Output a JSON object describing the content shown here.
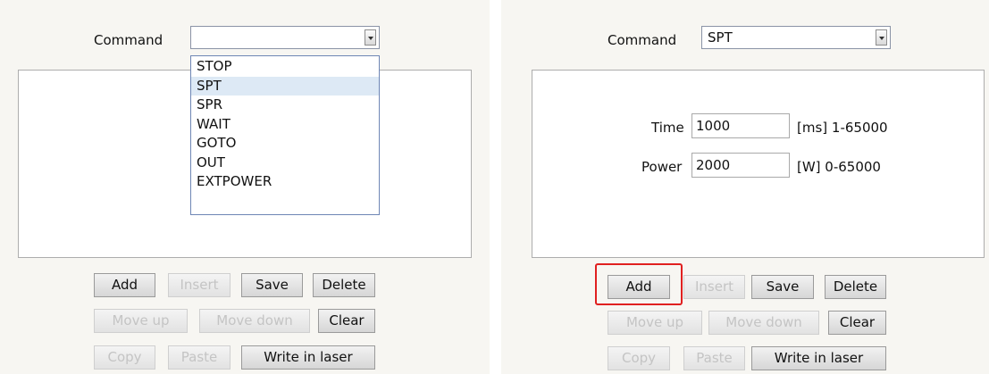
{
  "left": {
    "command_label": "Command",
    "command_value": "",
    "dropdown_items": [
      "STOP",
      "SPT",
      "SPR",
      "WAIT",
      "GOTO",
      "OUT",
      "EXTPOWER"
    ],
    "dropdown_selected": "SPT",
    "buttons": {
      "add": "Add",
      "insert": "Insert",
      "save": "Save",
      "delete": "Delete",
      "move_up": "Move up",
      "move_down": "Move down",
      "clear": "Clear",
      "copy": "Copy",
      "paste": "Paste",
      "write": "Write in laser"
    }
  },
  "right": {
    "command_label": "Command",
    "command_value": "SPT",
    "time_label": "Time",
    "time_value": "1000",
    "time_range": "[ms] 1-65000",
    "power_label": "Power",
    "power_value": "2000",
    "power_range": "[W] 0-65000",
    "buttons": {
      "add": "Add",
      "insert": "Insert",
      "save": "Save",
      "delete": "Delete",
      "move_up": "Move up",
      "move_down": "Move down",
      "clear": "Clear",
      "copy": "Copy",
      "paste": "Paste",
      "write": "Write in laser"
    },
    "highlight_color": "#e02020"
  },
  "icons": {
    "dropdown_arrow": "chevron-down-icon"
  }
}
